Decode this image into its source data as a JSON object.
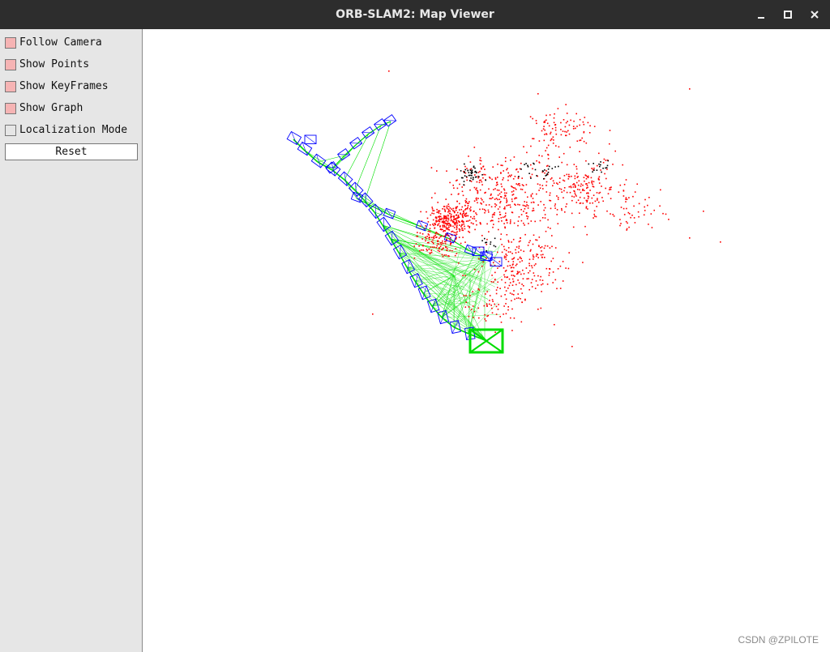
{
  "window": {
    "title": "ORB-SLAM2: Map Viewer",
    "controls": [
      "minimize-icon",
      "maximize-icon",
      "close-icon"
    ]
  },
  "panel": {
    "checkboxes": [
      {
        "label": "Follow Camera",
        "checked": true
      },
      {
        "label": "Show Points",
        "checked": true
      },
      {
        "label": "Show KeyFrames",
        "checked": true
      },
      {
        "label": "Show Graph",
        "checked": true
      },
      {
        "label": "Localization Mode",
        "checked": false
      }
    ],
    "reset_label": "Reset"
  },
  "viewer": {
    "colors": {
      "map_points": "#ff0000",
      "reference_points": "#000000",
      "keyframes": "#0000ff",
      "graph": "#00e000",
      "current_camera": "#00dd00"
    }
  },
  "watermark": "CSDN @ZPILOTE"
}
